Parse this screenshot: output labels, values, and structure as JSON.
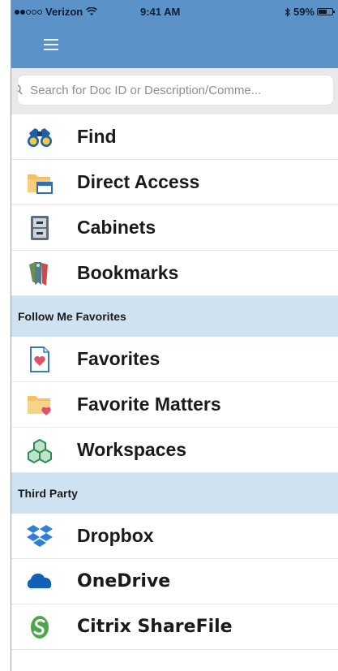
{
  "status": {
    "carrier": "Verizon",
    "time": "9:41 AM",
    "battery": "59%"
  },
  "search": {
    "placeholder": "Search for Doc ID or Description/Comme..."
  },
  "menu": [
    {
      "label": "Find",
      "icon": "binoculars-icon"
    },
    {
      "label": "Direct Access",
      "icon": "folder-icon"
    },
    {
      "label": "Cabinets",
      "icon": "cabinet-icon"
    },
    {
      "label": "Bookmarks",
      "icon": "bookmarks-icon"
    }
  ],
  "favorites_section": {
    "title": "Follow Me Favorites"
  },
  "favorites": [
    {
      "label": "Favorites",
      "icon": "favorites-icon"
    },
    {
      "label": "Favorite Matters",
      "icon": "favorite-matters-icon"
    },
    {
      "label": "Workspaces",
      "icon": "workspaces-icon"
    }
  ],
  "third_party_section": {
    "title": "Third Party"
  },
  "third_party": [
    {
      "label": "Dropbox",
      "icon": "dropbox-icon"
    },
    {
      "label": "OneDrive",
      "icon": "onedrive-icon"
    },
    {
      "label": "Citrix ShareFile",
      "icon": "sharefile-icon"
    }
  ],
  "colors": {
    "nav": "#5b93c9",
    "section": "#cfe2f1",
    "search_bg": "#e9e9eb"
  }
}
